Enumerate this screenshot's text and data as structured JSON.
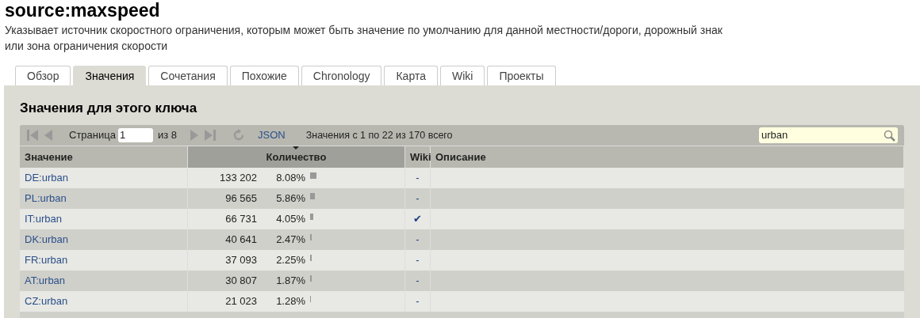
{
  "title": "source:maxspeed",
  "description": "Указывает источник скоростного ограничения, которым может быть значение по умолчанию для данной местности/дороги, дорожный знак или зона ограничения скорости",
  "tabs": [
    {
      "label": "Обзор",
      "selected": false
    },
    {
      "label": "Значения",
      "selected": true
    },
    {
      "label": "Сочетания",
      "selected": false
    },
    {
      "label": "Похожие",
      "selected": false
    },
    {
      "label": "Chronology",
      "selected": false
    },
    {
      "label": "Карта",
      "selected": false
    },
    {
      "label": "Wiki",
      "selected": false
    },
    {
      "label": "Проекты",
      "selected": false
    }
  ],
  "section_title": "Значения для этого ключа",
  "toolbar": {
    "page_label": "Страница",
    "page_value": "1",
    "page_total": "из 8",
    "json_link": "JSON",
    "summary": "Значения с 1 по 22 из 170 всего",
    "search_value": "urban"
  },
  "columns": [
    "Значение",
    "Количество",
    "Wiki",
    "Описание"
  ],
  "rows": [
    {
      "value": "DE:urban",
      "count": "133 202",
      "percent": "8.08%",
      "wiki": "-"
    },
    {
      "value": "PL:urban",
      "count": "96 565",
      "percent": "5.86%",
      "wiki": "-"
    },
    {
      "value": "IT:urban",
      "count": "66 731",
      "percent": "4.05%",
      "wiki": "✔"
    },
    {
      "value": "DK:urban",
      "count": "40 641",
      "percent": "2.47%",
      "wiki": "-"
    },
    {
      "value": "FR:urban",
      "count": "37 093",
      "percent": "2.25%",
      "wiki": "-"
    },
    {
      "value": "AT:urban",
      "count": "30 807",
      "percent": "1.87%",
      "wiki": "-"
    },
    {
      "value": "CZ:urban",
      "count": "21 023",
      "percent": "1.28%",
      "wiki": "-"
    }
  ]
}
